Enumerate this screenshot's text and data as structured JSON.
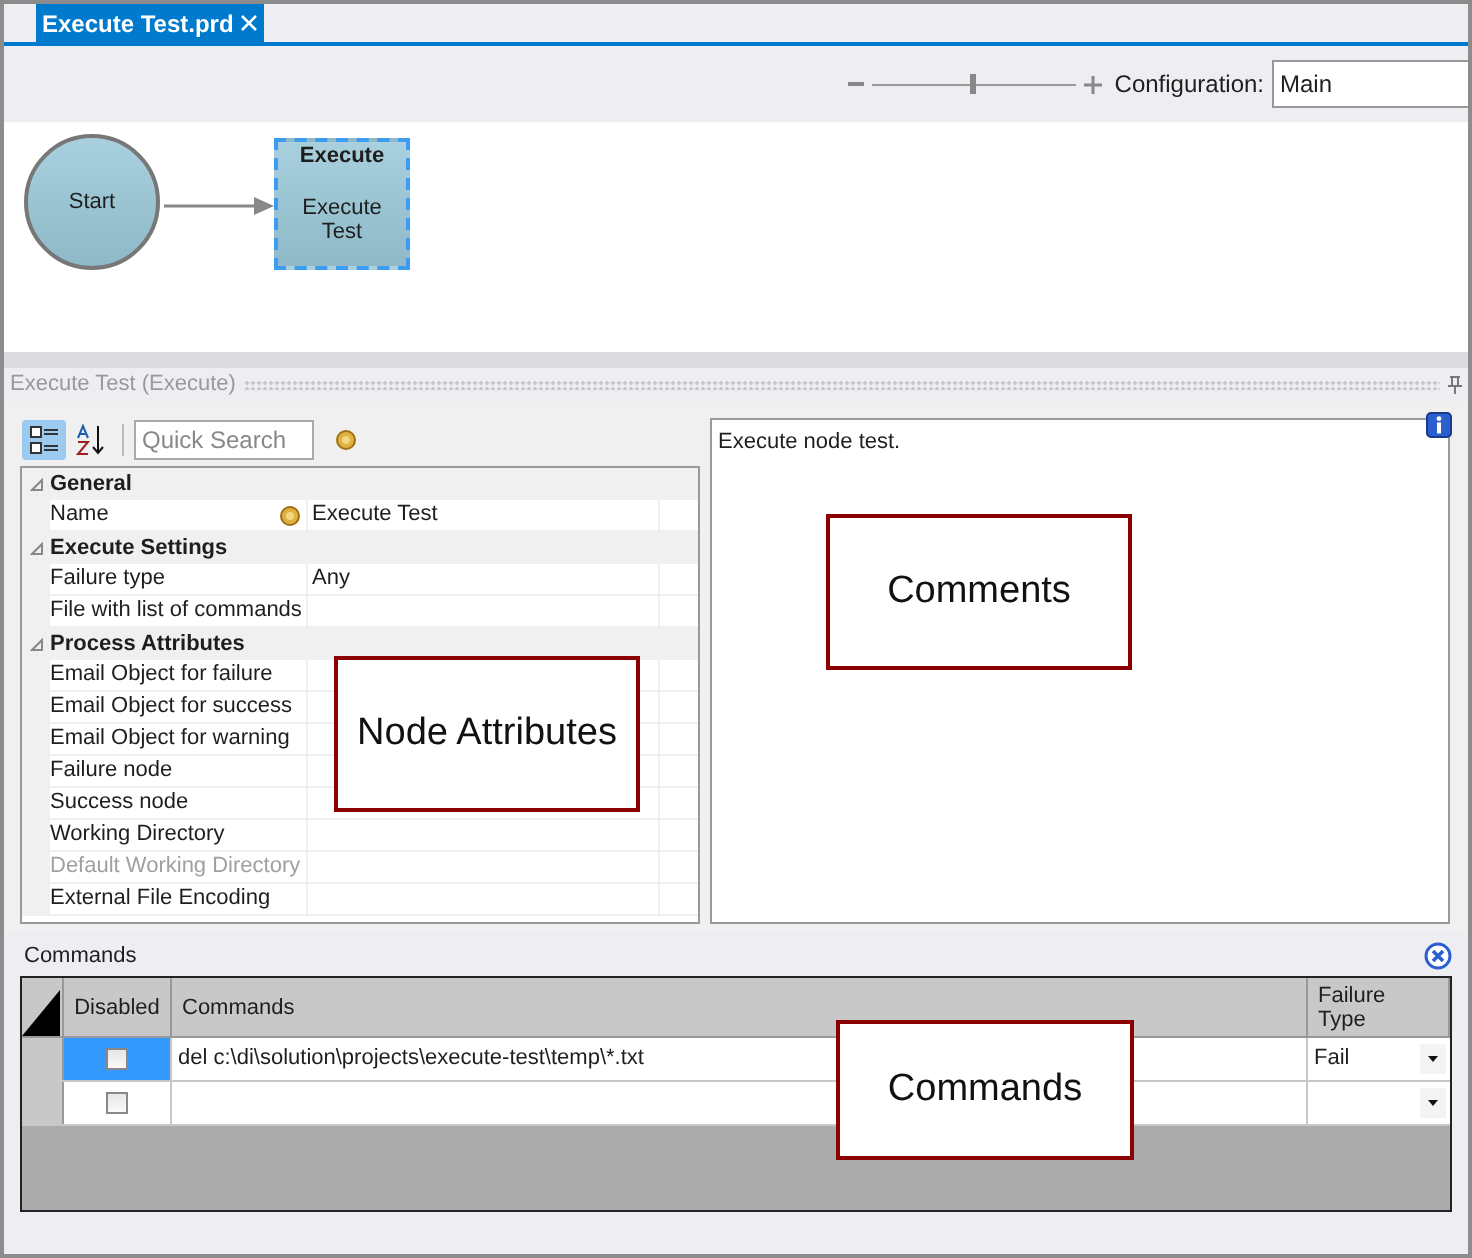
{
  "tab": {
    "title": "Execute Test.prd",
    "selected": true
  },
  "toolbar": {
    "zoom": {
      "level": 0.49
    },
    "configuration_label": "Configuration:",
    "configuration_value": "Main"
  },
  "diagram": {
    "nodes": [
      {
        "kind": "start",
        "label": "Start",
        "selected": false
      },
      {
        "kind": "task",
        "title": "Execute",
        "label": "Execute Test",
        "selected": true
      }
    ]
  },
  "panel_title": "Execute Test (Execute)",
  "properties": {
    "categorized": {
      "selected": true
    },
    "alphabetical": {
      "selected": false
    },
    "search": {
      "placeholder": "Quick Search"
    },
    "groups": [
      {
        "title": "General",
        "expanded": true,
        "rows": [
          {
            "name": "Name",
            "value": "Execute Test",
            "linked": true,
            "disabled": false
          }
        ]
      },
      {
        "title": "Execute Settings",
        "expanded": true,
        "rows": [
          {
            "name": "Failure type",
            "value": "Any",
            "disabled": false
          },
          {
            "name": "File with list of commands",
            "disabled": false
          }
        ]
      },
      {
        "title": "Process Attributes",
        "expanded": true,
        "rows": [
          {
            "name": "Email Object for failure",
            "disabled": false
          },
          {
            "name": "Email Object for success",
            "disabled": false
          },
          {
            "name": "Email Object for warning",
            "disabled": false
          },
          {
            "name": "Failure node",
            "disabled": false
          },
          {
            "name": "Success node",
            "disabled": false
          },
          {
            "name": "Working Directory",
            "disabled": false
          },
          {
            "name": "Default Working Directory",
            "disabled": true
          },
          {
            "name": "External File Encoding",
            "disabled": false
          }
        ]
      }
    ]
  },
  "comments": {
    "text": "Execute node test."
  },
  "commands": {
    "title": "Commands",
    "columns": [
      "Disabled",
      "Commands",
      "Failure Type"
    ],
    "rows": [
      {
        "selected": true,
        "disabled": false,
        "command": "del c:\\di\\solution\\projects\\execute-test\\temp\\*.txt",
        "failure_type": "Fail"
      },
      {
        "selected": false,
        "disabled": false
      }
    ]
  },
  "callouts": [
    {
      "label": "Node Attributes"
    },
    {
      "label": "Comments"
    },
    {
      "label": "Commands"
    }
  ]
}
